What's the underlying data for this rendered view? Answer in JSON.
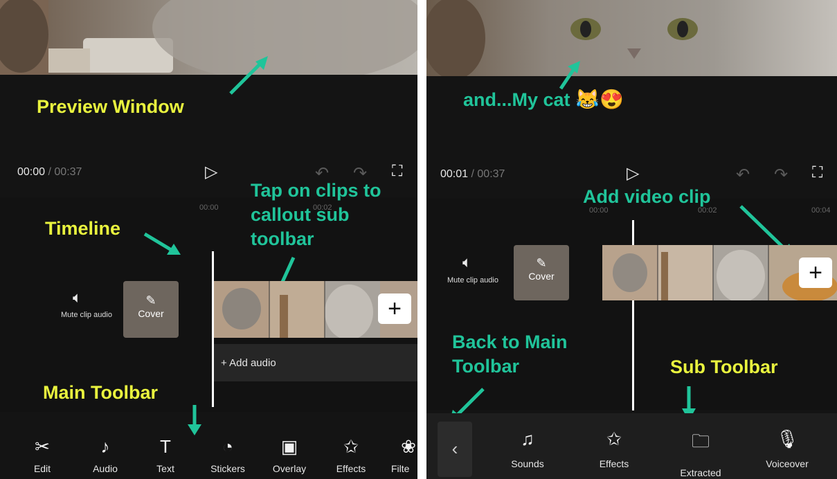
{
  "left": {
    "annotations": {
      "preview_window": "Preview Window",
      "timeline": "Timeline",
      "tap_on_clips": "Tap on clips to callout sub toolbar",
      "main_toolbar": "Main Toolbar"
    },
    "time_current": "00:00",
    "time_total": "/ 00:37",
    "ruler": [
      "00:00",
      "00:02"
    ],
    "mute_clip_audio": "Mute clip audio",
    "cover": "Cover",
    "add_audio": "+ Add audio",
    "toolbar": [
      "Edit",
      "Audio",
      "Text",
      "Stickers",
      "Overlay",
      "Effects",
      "Filte"
    ]
  },
  "right": {
    "annotations": {
      "my_cat": "and...My cat",
      "add_video_clip": "Add video clip",
      "back_to_main": "Back to Main Toolbar",
      "sub_toolbar": "Sub Toolbar"
    },
    "time_current": "00:01",
    "time_total": "/ 00:37",
    "ruler": [
      "00:00",
      "00:02",
      "00:04"
    ],
    "mute_clip_audio": "Mute clip audio",
    "cover": "Cover",
    "toolbar": [
      "Sounds",
      "Effects",
      "Extracted",
      "Voiceover"
    ]
  },
  "icons": {
    "play": "play-icon",
    "undo": "undo-icon",
    "redo": "redo-icon",
    "fullscreen": "fullscreen-icon",
    "speaker": "speaker-icon",
    "add": "plus-icon",
    "back": "chevron-left-icon",
    "emoji_cat": "😹",
    "emoji_heart_eyes": "😍"
  },
  "colors": {
    "annotation_yellow": "#e9f33e",
    "annotation_green": "#20c49a",
    "background": "#141414"
  }
}
